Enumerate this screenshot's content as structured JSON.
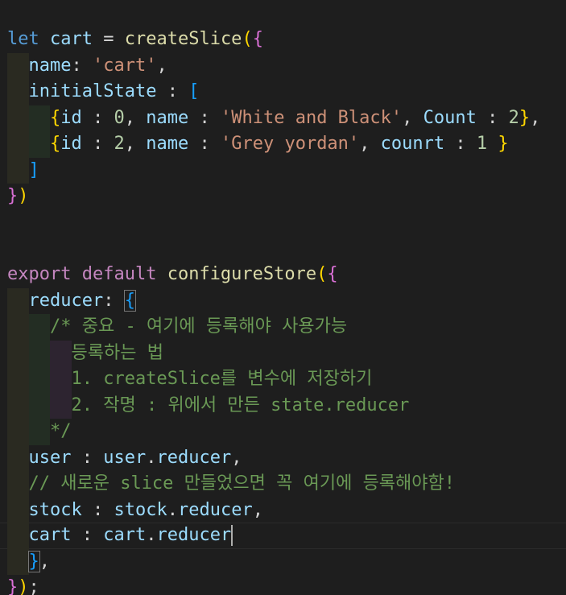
{
  "editor": {
    "current_line": "cart : cart.reducer",
    "lines": [
      "let cart = createSlice({",
      "name: 'cart',",
      "initialState : [",
      "{id : 0, name : 'White and Black', Count : 2},",
      "{id : 2, name : 'Grey yordan', counrt : 1 }",
      "]",
      "})",
      "export default configureStore({",
      "reducer: {",
      "/* 중요 - 여기에 등록해야 사용가능",
      "등록하는 법",
      "1. createSlice를 변수에 저장하기",
      "2. 작명 : 위에서 만든 state.reducer",
      "*/",
      "user : user.reducer,",
      "// 새로운 slice 만들었으면 꼭 여기에 등록해야함!",
      "stock : stock.reducer,",
      "cart : cart.reducer",
      "},",
      "});"
    ]
  },
  "colors": {
    "background": "#1e1e1e",
    "keyword": "#569cd6",
    "control_keyword": "#c586c0",
    "variable": "#9cdcfe",
    "function": "#dcdcaa",
    "string": "#ce9178",
    "number": "#b5cea8",
    "comment": "#6a9955",
    "bracket_level_1": "#ffd700",
    "bracket_level_2": "#da70d6",
    "bracket_level_3": "#179fff"
  }
}
